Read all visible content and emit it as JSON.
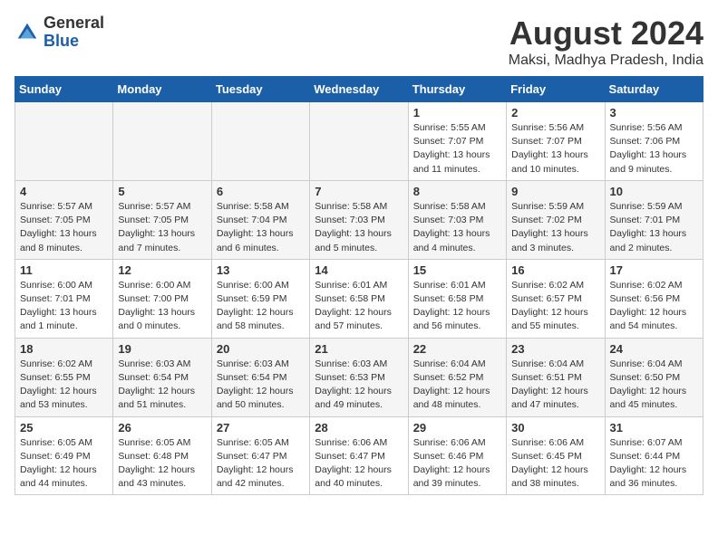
{
  "logo": {
    "general": "General",
    "blue": "Blue"
  },
  "title": "August 2024",
  "subtitle": "Maksi, Madhya Pradesh, India",
  "days_of_week": [
    "Sunday",
    "Monday",
    "Tuesday",
    "Wednesday",
    "Thursday",
    "Friday",
    "Saturday"
  ],
  "weeks": [
    [
      {
        "num": "",
        "detail": ""
      },
      {
        "num": "",
        "detail": ""
      },
      {
        "num": "",
        "detail": ""
      },
      {
        "num": "",
        "detail": ""
      },
      {
        "num": "1",
        "detail": "Sunrise: 5:55 AM\nSunset: 7:07 PM\nDaylight: 13 hours\nand 11 minutes."
      },
      {
        "num": "2",
        "detail": "Sunrise: 5:56 AM\nSunset: 7:07 PM\nDaylight: 13 hours\nand 10 minutes."
      },
      {
        "num": "3",
        "detail": "Sunrise: 5:56 AM\nSunset: 7:06 PM\nDaylight: 13 hours\nand 9 minutes."
      }
    ],
    [
      {
        "num": "4",
        "detail": "Sunrise: 5:57 AM\nSunset: 7:05 PM\nDaylight: 13 hours\nand 8 minutes."
      },
      {
        "num": "5",
        "detail": "Sunrise: 5:57 AM\nSunset: 7:05 PM\nDaylight: 13 hours\nand 7 minutes."
      },
      {
        "num": "6",
        "detail": "Sunrise: 5:58 AM\nSunset: 7:04 PM\nDaylight: 13 hours\nand 6 minutes."
      },
      {
        "num": "7",
        "detail": "Sunrise: 5:58 AM\nSunset: 7:03 PM\nDaylight: 13 hours\nand 5 minutes."
      },
      {
        "num": "8",
        "detail": "Sunrise: 5:58 AM\nSunset: 7:03 PM\nDaylight: 13 hours\nand 4 minutes."
      },
      {
        "num": "9",
        "detail": "Sunrise: 5:59 AM\nSunset: 7:02 PM\nDaylight: 13 hours\nand 3 minutes."
      },
      {
        "num": "10",
        "detail": "Sunrise: 5:59 AM\nSunset: 7:01 PM\nDaylight: 13 hours\nand 2 minutes."
      }
    ],
    [
      {
        "num": "11",
        "detail": "Sunrise: 6:00 AM\nSunset: 7:01 PM\nDaylight: 13 hours\nand 1 minute."
      },
      {
        "num": "12",
        "detail": "Sunrise: 6:00 AM\nSunset: 7:00 PM\nDaylight: 13 hours\nand 0 minutes."
      },
      {
        "num": "13",
        "detail": "Sunrise: 6:00 AM\nSunset: 6:59 PM\nDaylight: 12 hours\nand 58 minutes."
      },
      {
        "num": "14",
        "detail": "Sunrise: 6:01 AM\nSunset: 6:58 PM\nDaylight: 12 hours\nand 57 minutes."
      },
      {
        "num": "15",
        "detail": "Sunrise: 6:01 AM\nSunset: 6:58 PM\nDaylight: 12 hours\nand 56 minutes."
      },
      {
        "num": "16",
        "detail": "Sunrise: 6:02 AM\nSunset: 6:57 PM\nDaylight: 12 hours\nand 55 minutes."
      },
      {
        "num": "17",
        "detail": "Sunrise: 6:02 AM\nSunset: 6:56 PM\nDaylight: 12 hours\nand 54 minutes."
      }
    ],
    [
      {
        "num": "18",
        "detail": "Sunrise: 6:02 AM\nSunset: 6:55 PM\nDaylight: 12 hours\nand 53 minutes."
      },
      {
        "num": "19",
        "detail": "Sunrise: 6:03 AM\nSunset: 6:54 PM\nDaylight: 12 hours\nand 51 minutes."
      },
      {
        "num": "20",
        "detail": "Sunrise: 6:03 AM\nSunset: 6:54 PM\nDaylight: 12 hours\nand 50 minutes."
      },
      {
        "num": "21",
        "detail": "Sunrise: 6:03 AM\nSunset: 6:53 PM\nDaylight: 12 hours\nand 49 minutes."
      },
      {
        "num": "22",
        "detail": "Sunrise: 6:04 AM\nSunset: 6:52 PM\nDaylight: 12 hours\nand 48 minutes."
      },
      {
        "num": "23",
        "detail": "Sunrise: 6:04 AM\nSunset: 6:51 PM\nDaylight: 12 hours\nand 47 minutes."
      },
      {
        "num": "24",
        "detail": "Sunrise: 6:04 AM\nSunset: 6:50 PM\nDaylight: 12 hours\nand 45 minutes."
      }
    ],
    [
      {
        "num": "25",
        "detail": "Sunrise: 6:05 AM\nSunset: 6:49 PM\nDaylight: 12 hours\nand 44 minutes."
      },
      {
        "num": "26",
        "detail": "Sunrise: 6:05 AM\nSunset: 6:48 PM\nDaylight: 12 hours\nand 43 minutes."
      },
      {
        "num": "27",
        "detail": "Sunrise: 6:05 AM\nSunset: 6:47 PM\nDaylight: 12 hours\nand 42 minutes."
      },
      {
        "num": "28",
        "detail": "Sunrise: 6:06 AM\nSunset: 6:47 PM\nDaylight: 12 hours\nand 40 minutes."
      },
      {
        "num": "29",
        "detail": "Sunrise: 6:06 AM\nSunset: 6:46 PM\nDaylight: 12 hours\nand 39 minutes."
      },
      {
        "num": "30",
        "detail": "Sunrise: 6:06 AM\nSunset: 6:45 PM\nDaylight: 12 hours\nand 38 minutes."
      },
      {
        "num": "31",
        "detail": "Sunrise: 6:07 AM\nSunset: 6:44 PM\nDaylight: 12 hours\nand 36 minutes."
      }
    ]
  ]
}
